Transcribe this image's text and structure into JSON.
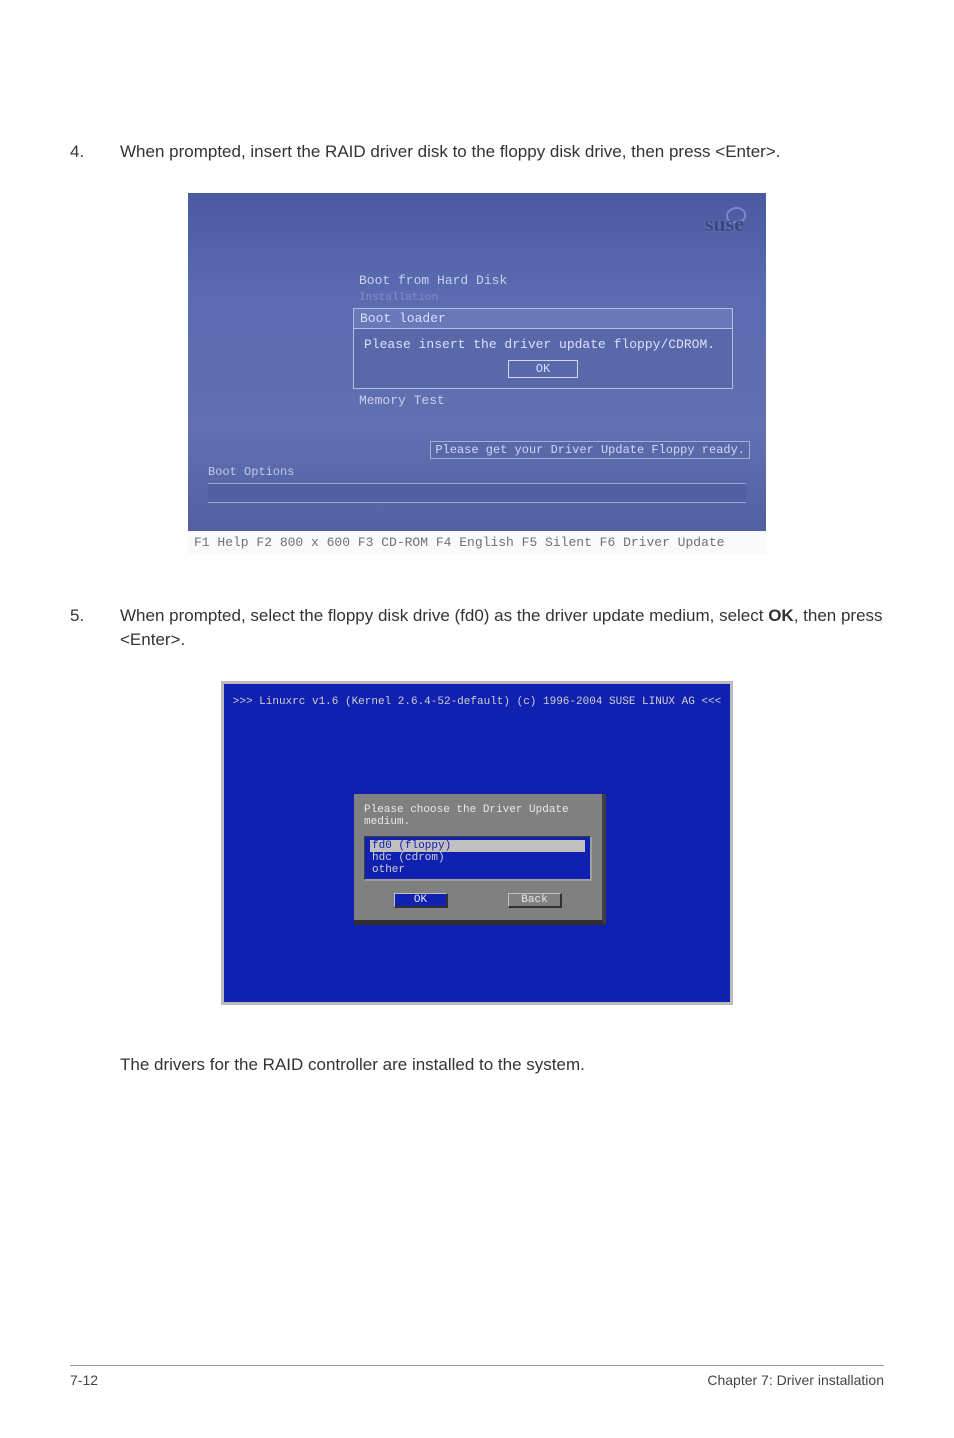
{
  "step4": {
    "num": "4.",
    "text_a": "When prompted, insert the RAID driver disk to the floppy disk drive, then press <Enter>."
  },
  "fig1": {
    "logo": "suse",
    "boot_hard": "Boot from Hard Disk",
    "installation": "Installation",
    "loader_title": "Boot loader",
    "loader_msg": "Please insert the driver update floppy/CDROM.",
    "ok": "OK",
    "memtest": "Memory Test",
    "ready": "Please get your Driver Update Floppy ready.",
    "boot_options": "Boot Options",
    "fkeys": "F1 Help  F2 800 x 600  F3 CD-ROM  F4 English  F5 Silent  F6 Driver Update"
  },
  "step5": {
    "num": "5.",
    "text_a": "When prompted, select the floppy disk drive (fd0) as the driver update medium, select ",
    "bold": "OK",
    "text_b": ", then press <Enter>."
  },
  "fig2": {
    "header": ">>> Linuxrc v1.6 (Kernel 2.6.4-52-default) (c) 1996-2004 SUSE LINUX AG <<<",
    "prompt": "Please choose the Driver Update medium.",
    "opt1": "fd0 (floppy)",
    "opt2": "hdc (cdrom)",
    "opt3": "other",
    "ok": "OK",
    "back": "Back"
  },
  "closing": "The drivers for the RAID controller are installed to the system.",
  "footer": {
    "left": "7-12",
    "right": "Chapter 7: Driver installation"
  }
}
